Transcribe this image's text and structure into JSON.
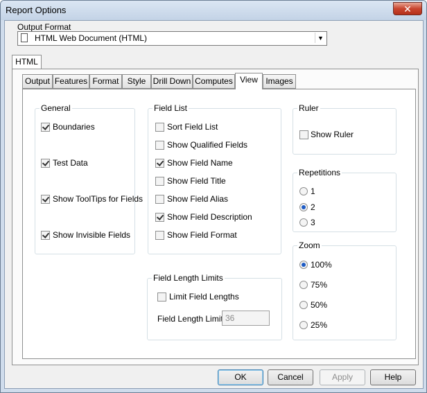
{
  "window": {
    "title": "Report Options",
    "close_glyph": "✕"
  },
  "output_format": {
    "label": "Output Format",
    "value": "HTML Web Document (HTML)",
    "icon": "document-icon"
  },
  "outer_tab": {
    "label": "HTML"
  },
  "tabs": [
    {
      "label": "Output"
    },
    {
      "label": "Features"
    },
    {
      "label": "Format"
    },
    {
      "label": "Style"
    },
    {
      "label": "Drill Down"
    },
    {
      "label": "Computes"
    },
    {
      "label": "View",
      "selected": true
    },
    {
      "label": "Images"
    }
  ],
  "general": {
    "title": "General",
    "items": [
      {
        "label": "Boundaries",
        "checked": true
      },
      {
        "label": "Test Data",
        "checked": true
      },
      {
        "label": "Show ToolTips for Fields",
        "checked": true
      },
      {
        "label": "Show Invisible Fields",
        "checked": true
      }
    ]
  },
  "field_list": {
    "title": "Field List",
    "items": [
      {
        "label": "Sort Field List",
        "checked": false
      },
      {
        "label": "Show Qualified Fields",
        "checked": false
      },
      {
        "label": "Show Field Name",
        "checked": true
      },
      {
        "label": "Show Field Title",
        "checked": false
      },
      {
        "label": "Show Field Alias",
        "checked": false
      },
      {
        "label": "Show Field Description",
        "checked": true
      },
      {
        "label": "Show Field Format",
        "checked": false
      }
    ]
  },
  "field_length": {
    "title": "Field Length Limits",
    "limit_label": "Limit Field Lengths",
    "limit_checked": false,
    "value_label": "Field Length Limit",
    "value": "36"
  },
  "ruler": {
    "title": "Ruler",
    "label": "Show Ruler",
    "checked": false
  },
  "repetitions": {
    "title": "Repetitions",
    "options": [
      {
        "label": "1"
      },
      {
        "label": "2",
        "selected": true
      },
      {
        "label": "3"
      }
    ]
  },
  "zoom": {
    "title": "Zoom",
    "options": [
      {
        "label": "100%",
        "selected": true
      },
      {
        "label": "75%"
      },
      {
        "label": "50%"
      },
      {
        "label": "25%"
      }
    ]
  },
  "buttons": {
    "ok": "OK",
    "cancel": "Cancel",
    "apply": "Apply",
    "help": "Help"
  }
}
